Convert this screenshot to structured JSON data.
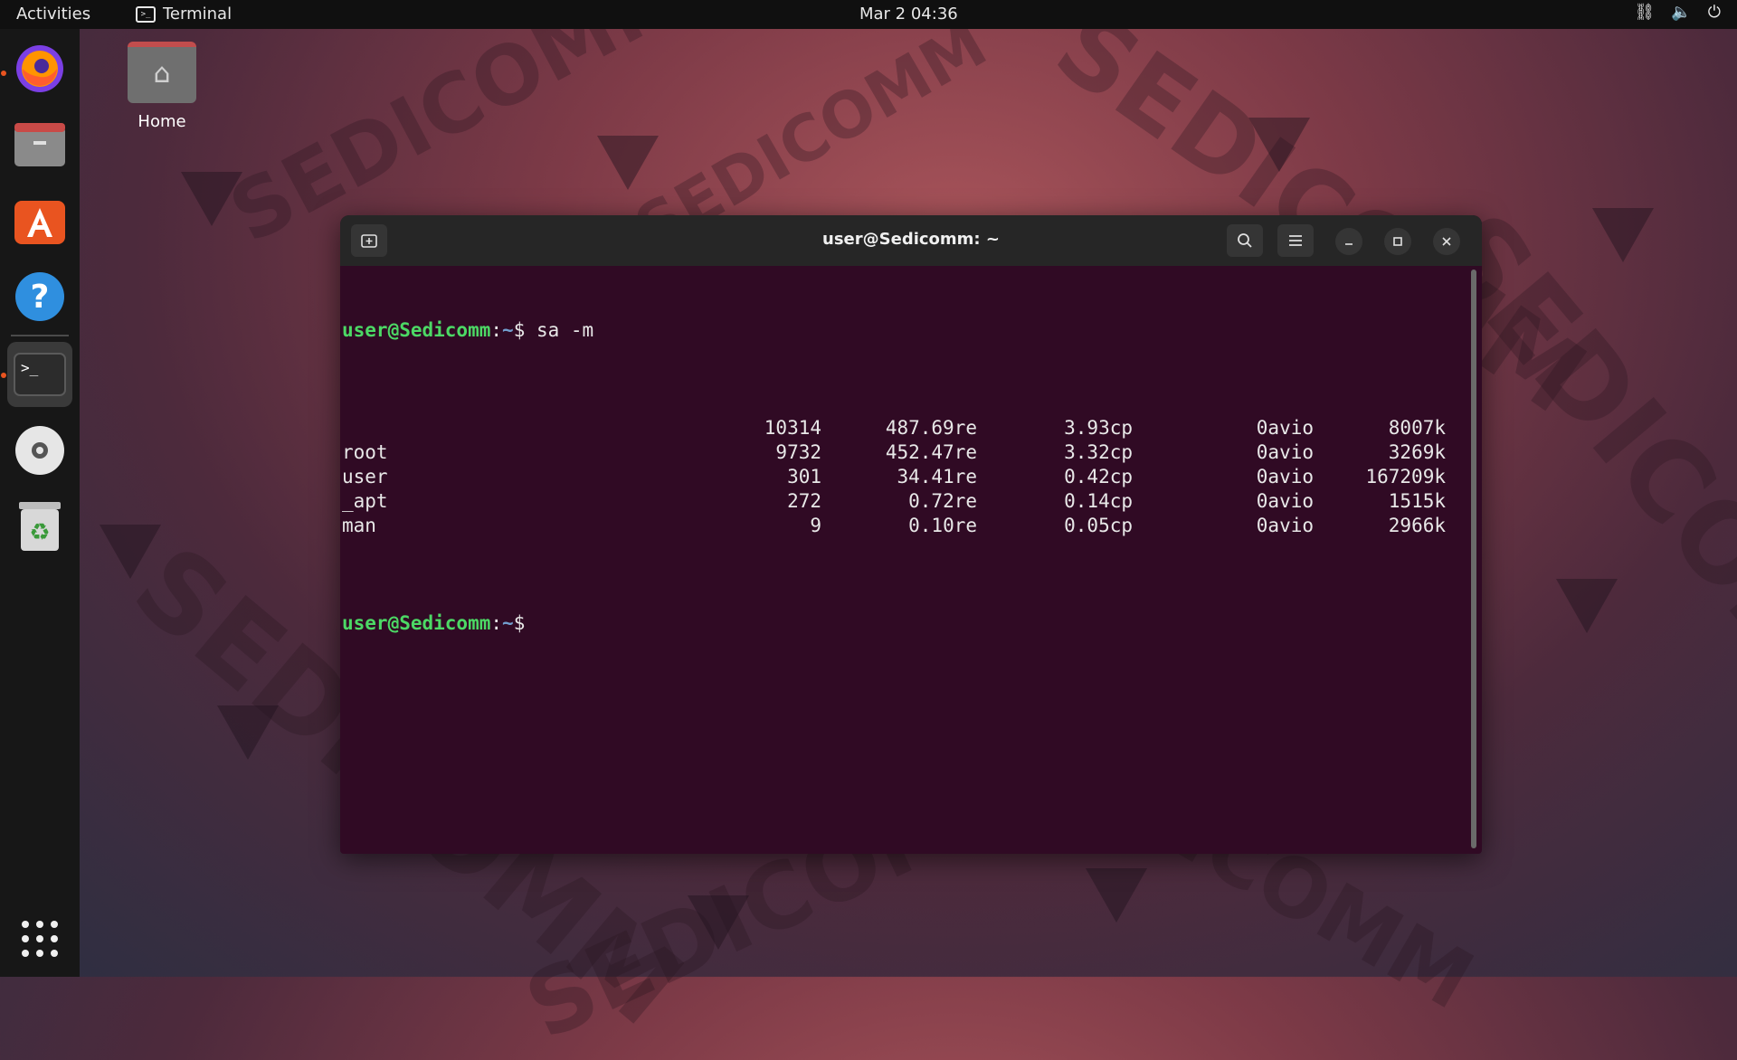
{
  "topbar": {
    "activities": "Activities",
    "app_name": "Terminal",
    "clock": "Mar 2  04:36"
  },
  "desktop": {
    "home_label": "Home"
  },
  "terminal": {
    "title": "user@Sedicomm: ~",
    "prompt_user": "user@Sedicomm",
    "prompt_sep": ":",
    "prompt_path": "~",
    "prompt_dollar": "$",
    "command": " sa -m",
    "rows": [
      {
        "name": "",
        "calls": "10314",
        "re": "487.69re",
        "cp": "3.93cp",
        "avio": "0avio",
        "mem": "8007k"
      },
      {
        "name": "root",
        "calls": "9732",
        "re": "452.47re",
        "cp": "3.32cp",
        "avio": "0avio",
        "mem": "3269k"
      },
      {
        "name": "user",
        "calls": "301",
        "re": "34.41re",
        "cp": "0.42cp",
        "avio": "0avio",
        "mem": "167209k"
      },
      {
        "name": "_apt",
        "calls": "272",
        "re": "0.72re",
        "cp": "0.14cp",
        "avio": "0avio",
        "mem": "1515k"
      },
      {
        "name": "man",
        "calls": "9",
        "re": "0.10re",
        "cp": "0.05cp",
        "avio": "0avio",
        "mem": "2966k"
      }
    ]
  },
  "colors": {
    "terminal_bg": "#300a24",
    "prompt_user": "#4cd965",
    "prompt_path": "#729fcf",
    "accent": "#e95420"
  },
  "icons": {
    "dock": [
      "firefox-icon",
      "files-icon",
      "software-icon",
      "help-icon",
      "terminal-icon",
      "disc-icon",
      "trash-icon",
      "app-grid-icon"
    ],
    "titlebar": [
      "new-tab-icon",
      "search-icon",
      "hamburger-menu-icon",
      "minimize-icon",
      "maximize-icon",
      "close-icon"
    ],
    "tray": [
      "network-icon",
      "volume-icon",
      "power-icon"
    ]
  }
}
